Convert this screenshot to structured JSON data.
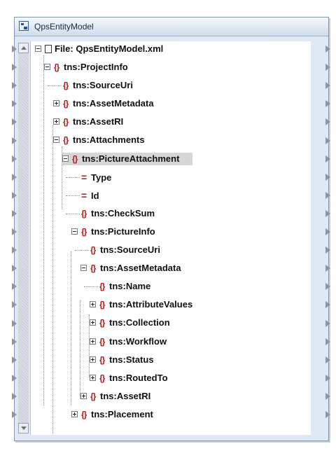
{
  "window": {
    "title": "QpsEntityModel"
  },
  "tree": {
    "file_label": "File: QpsEntityModel.xml",
    "nodes": [
      {
        "label": "tns:ProjectInfo",
        "kind": "element",
        "expander": "minus"
      },
      {
        "label": "tns:SourceUri",
        "kind": "element",
        "expander": "none"
      },
      {
        "label": "tns:AssetMetadata",
        "kind": "element",
        "expander": "plus"
      },
      {
        "label": "tns:AssetRI",
        "kind": "element",
        "expander": "plus"
      },
      {
        "label": "tns:Attachments",
        "kind": "element",
        "expander": "minus"
      },
      {
        "label": "tns:PictureAttachment",
        "kind": "element",
        "expander": "minus",
        "selected": true
      },
      {
        "label": "Type",
        "kind": "attribute",
        "expander": "none"
      },
      {
        "label": "Id",
        "kind": "attribute",
        "expander": "none"
      },
      {
        "label": "tns:CheckSum",
        "kind": "element",
        "expander": "none"
      },
      {
        "label": "tns:PictureInfo",
        "kind": "element",
        "expander": "minus"
      },
      {
        "label": "tns:SourceUri",
        "kind": "element",
        "expander": "none"
      },
      {
        "label": "tns:AssetMetadata",
        "kind": "element",
        "expander": "minus"
      },
      {
        "label": "tns:Name",
        "kind": "element",
        "expander": "none"
      },
      {
        "label": "tns:AttributeValues",
        "kind": "element",
        "expander": "plus"
      },
      {
        "label": "tns:Collection",
        "kind": "element",
        "expander": "plus"
      },
      {
        "label": "tns:Workflow",
        "kind": "element",
        "expander": "plus"
      },
      {
        "label": "tns:Status",
        "kind": "element",
        "expander": "plus"
      },
      {
        "label": "tns:RoutedTo",
        "kind": "element",
        "expander": "plus"
      },
      {
        "label": "tns:AssetRI",
        "kind": "element",
        "expander": "plus"
      },
      {
        "label": "tns:Placement",
        "kind": "element",
        "expander": "plus"
      }
    ]
  },
  "icons": {
    "element": "element-brace-icon",
    "attribute": "attribute-equals-icon",
    "file": "file-icon"
  },
  "colors": {
    "accent": "#b3191d",
    "selection": "#d6d6d6"
  }
}
